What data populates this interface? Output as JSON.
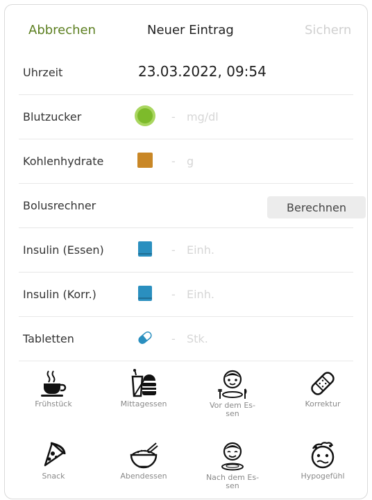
{
  "header": {
    "cancel_label": "Abbrechen",
    "title": "Neuer Eintrag",
    "save_label": "Sichern"
  },
  "rows": {
    "time": {
      "label": "Uhrzeit",
      "value": "23.03.2022, 09:54"
    },
    "glucose": {
      "label": "Blutzucker",
      "dash": "-",
      "unit": "mg/dl",
      "icon": "glucose-icon",
      "color": "#7dbb2b"
    },
    "carbs": {
      "label": "Kohlenhydrate",
      "dash": "-",
      "unit": "g",
      "icon": "carbs-icon",
      "color": "#c98726"
    },
    "bolus": {
      "label": "Bolusrechner",
      "button": "Berechnen"
    },
    "insulin_meal": {
      "label": "Insulin (Essen)",
      "dash": "-",
      "unit": "Einh.",
      "icon": "insulin-pen-icon",
      "color": "#2a8fbf"
    },
    "insulin_corr": {
      "label": "Insulin (Korr.)",
      "dash": "-",
      "unit": "Einh.",
      "icon": "insulin-pen-icon",
      "color": "#2a8fbf"
    },
    "tablets": {
      "label": "Tabletten",
      "dash": "-",
      "unit": "Stk.",
      "icon": "pill-icon",
      "color": "#2a8fbf"
    }
  },
  "categories": [
    {
      "label": "Frühstück",
      "icon": "coffee-cup-icon"
    },
    {
      "label": "Mittagessen",
      "icon": "lunch-icon"
    },
    {
      "label": "Vor dem Es-\nsen",
      "icon": "before-meal-icon"
    },
    {
      "label": "Korrektur",
      "icon": "bandage-icon"
    },
    {
      "label": "Snack",
      "icon": "pizza-slice-icon"
    },
    {
      "label": "Abendessen",
      "icon": "dinner-bowl-icon"
    },
    {
      "label": "Nach dem Es-\nsen",
      "icon": "after-meal-icon"
    },
    {
      "label": "Hypogefühl",
      "icon": "hypo-face-icon"
    }
  ]
}
